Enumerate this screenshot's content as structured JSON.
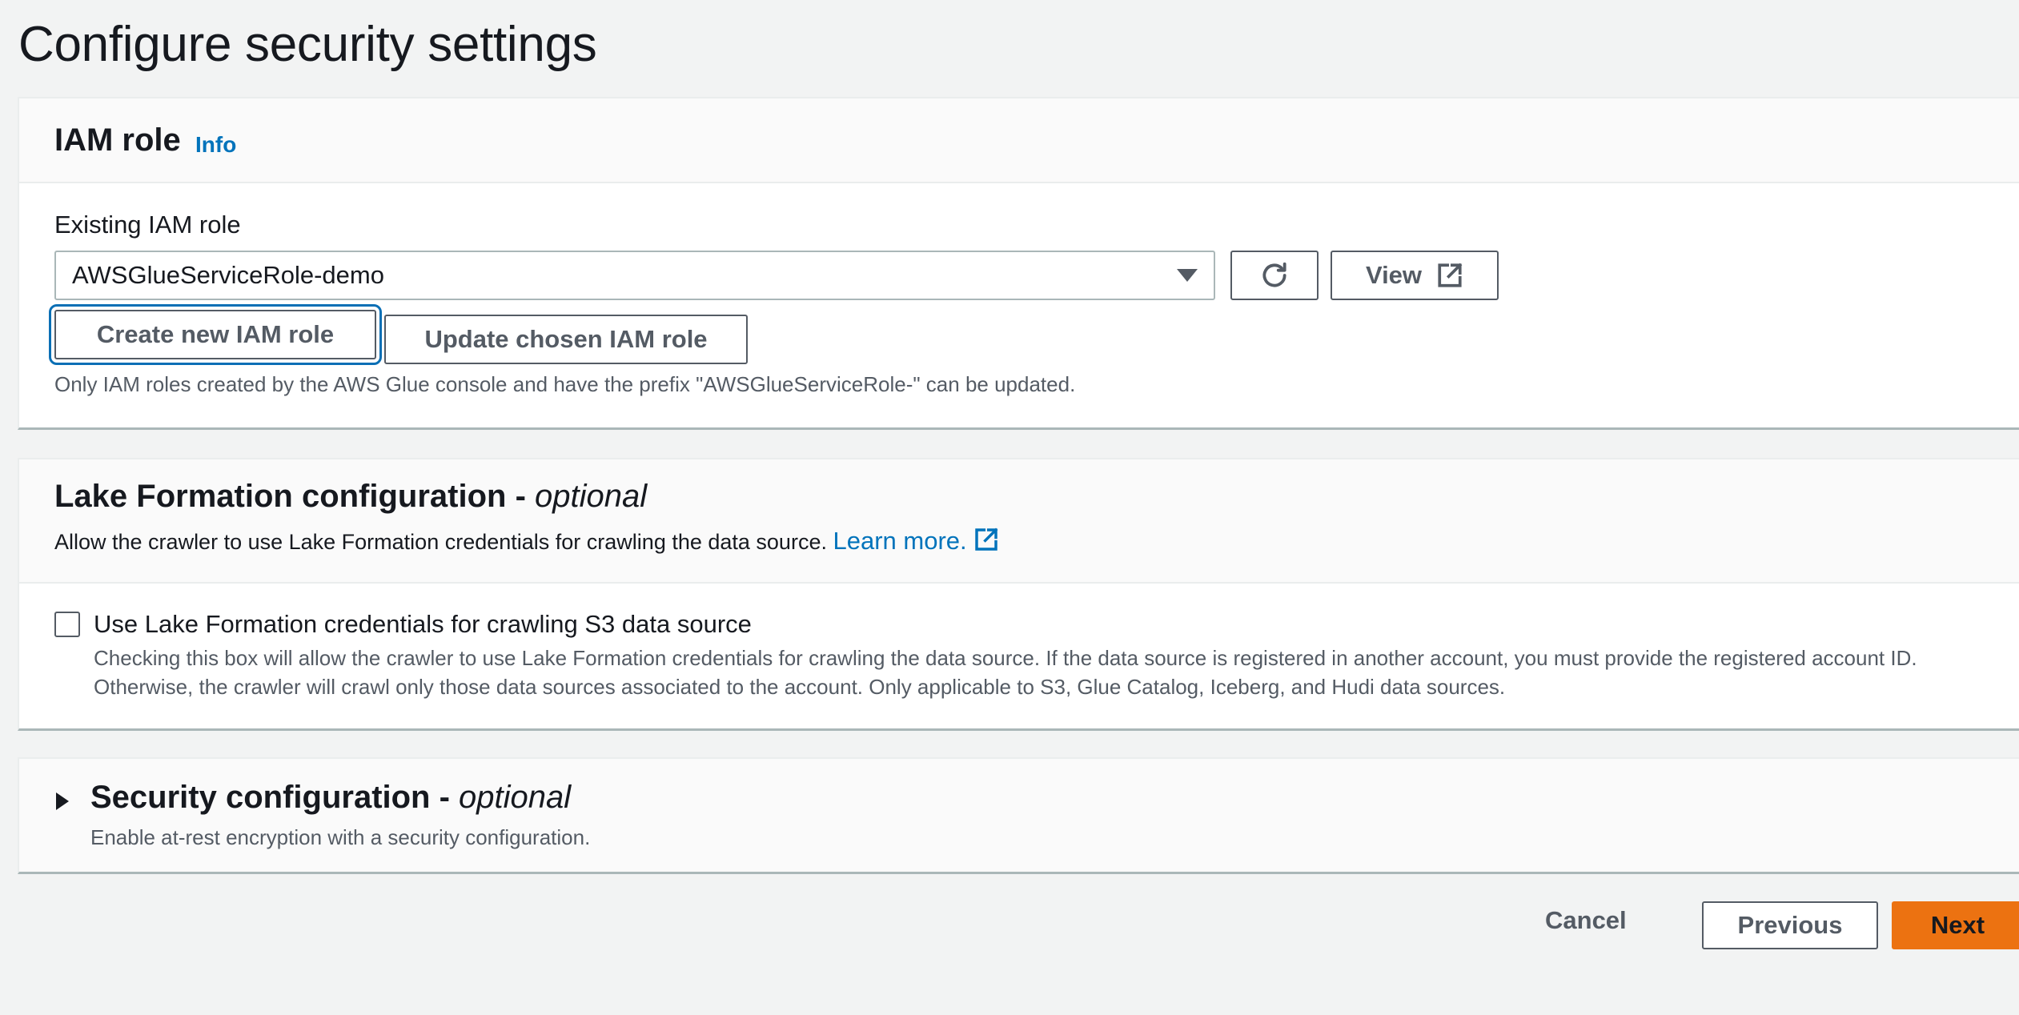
{
  "page": {
    "title": "Configure security settings"
  },
  "iam_role": {
    "title": "IAM role",
    "info_link": "Info",
    "field_label": "Existing IAM role",
    "selected_role": "AWSGlueServiceRole-demo",
    "view_label": "View",
    "create_label": "Create new IAM role",
    "update_label": "Update chosen IAM role",
    "hint": "Only IAM roles created by the AWS Glue console and have the prefix \"AWSGlueServiceRole-\" can be updated."
  },
  "lake_formation": {
    "title": "Lake Formation configuration - ",
    "title_optional": "optional",
    "description": "Allow the crawler to use Lake Formation credentials for crawling the data source.",
    "learn_more": "Learn more.",
    "checkbox_label": "Use Lake Formation credentials for crawling S3 data source",
    "checkbox_checked": false,
    "checkbox_description_line1": "Checking this box will allow the crawler to use Lake Formation credentials for crawling the data source. If the data source is registered in another account, you must provide the registered account ID.",
    "checkbox_description_line2": "Otherwise, the crawler will crawl only those data sources associated to the account. Only applicable to S3, Glue Catalog, Iceberg, and Hudi data sources."
  },
  "security_configuration": {
    "title": "Security configuration - ",
    "title_optional": "optional",
    "description": "Enable at-rest encryption with a security configuration.",
    "expanded": false
  },
  "footer": {
    "cancel_label": "Cancel",
    "previous_label": "Previous",
    "next_label": "Next"
  },
  "colors": {
    "link": "#0073bb",
    "primary": "#ec7211",
    "focus_ring": "#0a6fb5",
    "background": "#f2f3f3"
  },
  "icons": {
    "refresh": "refresh-icon",
    "external": "external-link-icon",
    "dropdown": "caret-down-icon",
    "expand": "caret-right-icon"
  }
}
